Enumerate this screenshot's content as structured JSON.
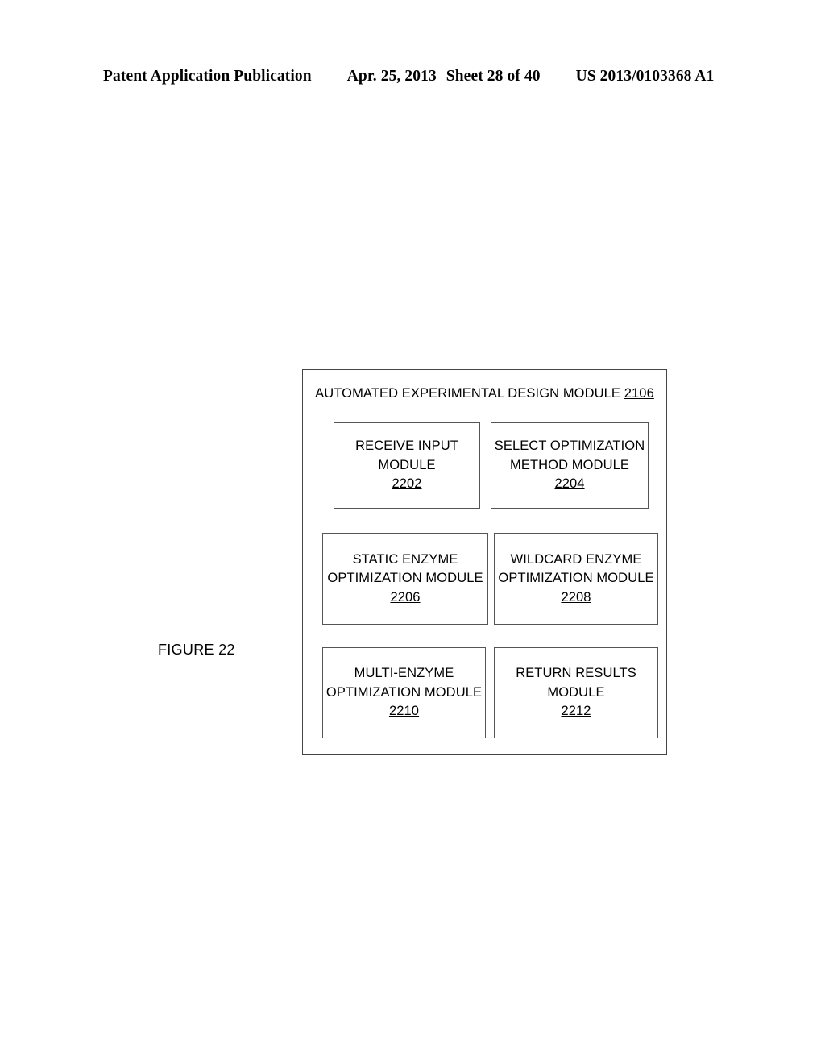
{
  "header": {
    "publication": "Patent Application Publication",
    "date": "Apr. 25, 2013",
    "sheet": "Sheet 28 of 40",
    "patent_number": "US 2013/0103368 A1"
  },
  "figure": {
    "label": "FIGURE 22"
  },
  "diagram": {
    "container": {
      "title_text": "AUTOMATED EXPERIMENTAL DESIGN MODULE",
      "title_ref": "2106"
    },
    "boxes": [
      {
        "line1": "RECEIVE INPUT",
        "line2": "MODULE",
        "ref": "2202"
      },
      {
        "line1": "SELECT OPTIMIZATION",
        "line2": "METHOD MODULE",
        "ref": "2204"
      },
      {
        "line1": "STATIC ENZYME",
        "line2": "OPTIMIZATION MODULE",
        "ref": "2206"
      },
      {
        "line1": "WILDCARD ENZYME",
        "line2": "OPTIMIZATION MODULE",
        "ref": "2208"
      },
      {
        "line1": "MULTI-ENZYME",
        "line2": "OPTIMIZATION MODULE",
        "ref": "2210"
      },
      {
        "line1": "RETURN RESULTS",
        "line2": "MODULE",
        "ref": "2212"
      }
    ]
  },
  "colors": {
    "page_background": "#ffffff",
    "ink": "#000000",
    "box_border": "#555555",
    "container_border": "#444444"
  }
}
